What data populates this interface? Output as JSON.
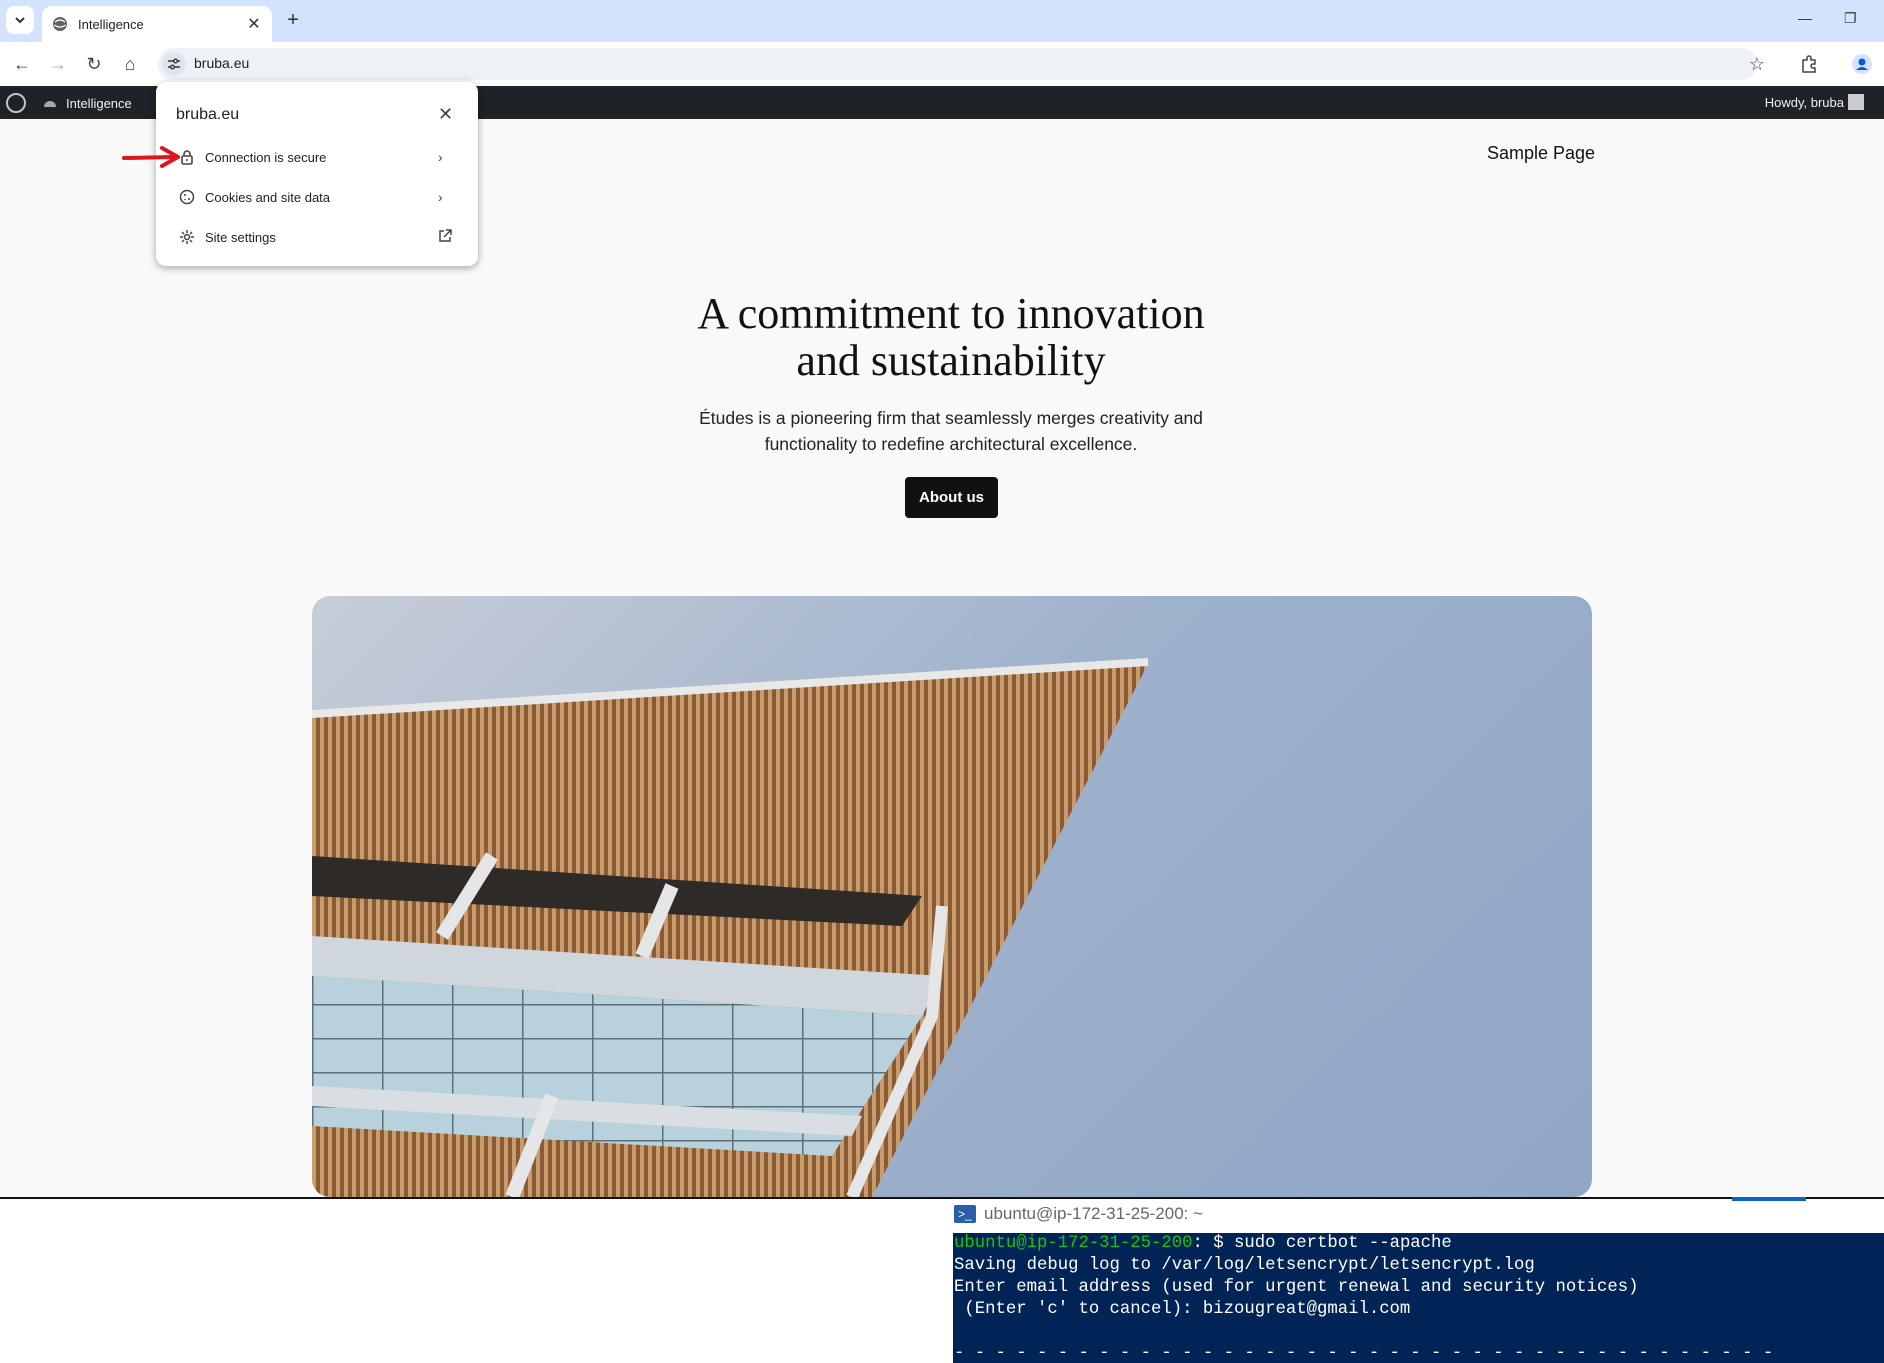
{
  "browser": {
    "tab_title": "Intelligence",
    "url": "bruba.eu"
  },
  "admin_bar": {
    "site_name": "Intelligence",
    "greeting": "Howdy, bruba"
  },
  "site_popup": {
    "domain": "bruba.eu",
    "items": [
      {
        "label": "Connection is secure",
        "icon": "lock-icon"
      },
      {
        "label": "Cookies and site data",
        "icon": "cookie-icon"
      },
      {
        "label": "Site settings",
        "icon": "gear-icon"
      }
    ]
  },
  "page": {
    "nav_link": "Sample Page",
    "hero_title_line1": "A commitment to innovation",
    "hero_title_line2": "and sustainability",
    "hero_sub_line1": "Études is a pioneering firm that seamlessly merges creativity and",
    "hero_sub_line2": "functionality to redefine architectural excellence.",
    "cta_label": "About us"
  },
  "terminal": {
    "window_title": "ubuntu@ip-172-31-25-200: ~",
    "prompt_user": "ubuntu@ip-172-31-25-200",
    "prompt_rest": ": $ sudo certbot --apache",
    "line2": "Saving debug log to /var/log/letsencrypt/letsencrypt.log",
    "line3": "Enter email address (used for urgent renewal and security notices)",
    "line4": " (Enter 'c' to cancel): bizougreat@gmail.com",
    "line6": "- - - - - - - - - - - - - - - - - - - - - - - - - - - - - - - - - - - - - - - -"
  },
  "colors": {
    "tabbar": "#d3e3fd",
    "admin_bar": "#1d2327",
    "terminal_bg": "#012456",
    "prompt_green": "#16c60c",
    "annotation_red": "#e0141e"
  }
}
